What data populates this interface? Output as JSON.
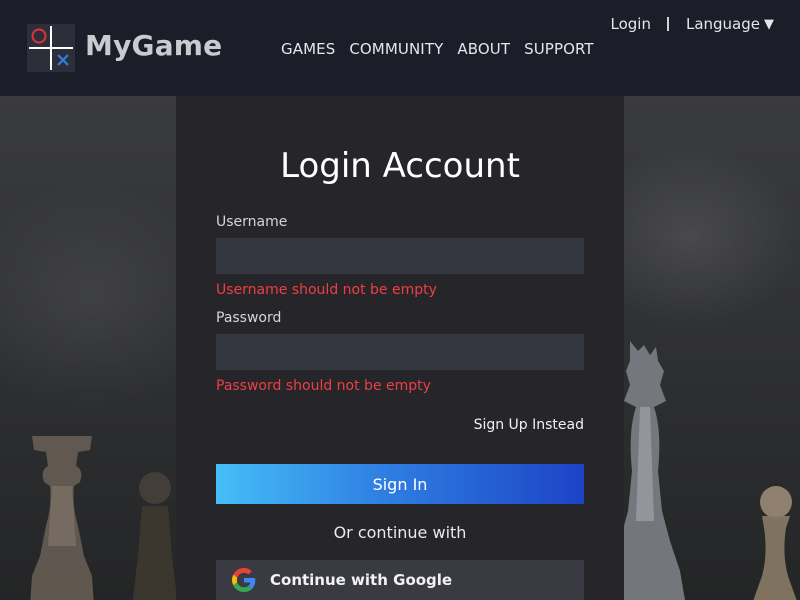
{
  "brand": {
    "name": "MyGame",
    "logo_icon": "tic-tac-toe-icon"
  },
  "nav": {
    "items": [
      {
        "label": "GAMES"
      },
      {
        "label": "COMMUNITY"
      },
      {
        "label": "ABOUT"
      },
      {
        "label": "SUPPORT"
      }
    ]
  },
  "top_right": {
    "login": "Login",
    "language": "Language",
    "language_caret": "▼"
  },
  "form": {
    "title": "Login Account",
    "username_label": "Username",
    "username_value": "",
    "username_error": "Username should not be empty",
    "password_label": "Password",
    "password_value": "",
    "password_error": "Password should not be empty",
    "signup_link": "Sign Up Instead",
    "signin_button": "Sign In",
    "divider_text": "Or continue with",
    "google_button": "Continue with Google",
    "google_icon": "google-icon"
  },
  "colors": {
    "header_bg": "#1b1d28",
    "panel_bg": "#26262a",
    "input_bg": "#343640",
    "error": "#ee3e45",
    "button_gradient_start": "#45bef7",
    "button_gradient_end": "#1d43c6",
    "logo_o": "#e0323a",
    "logo_x": "#2f7fe2"
  }
}
